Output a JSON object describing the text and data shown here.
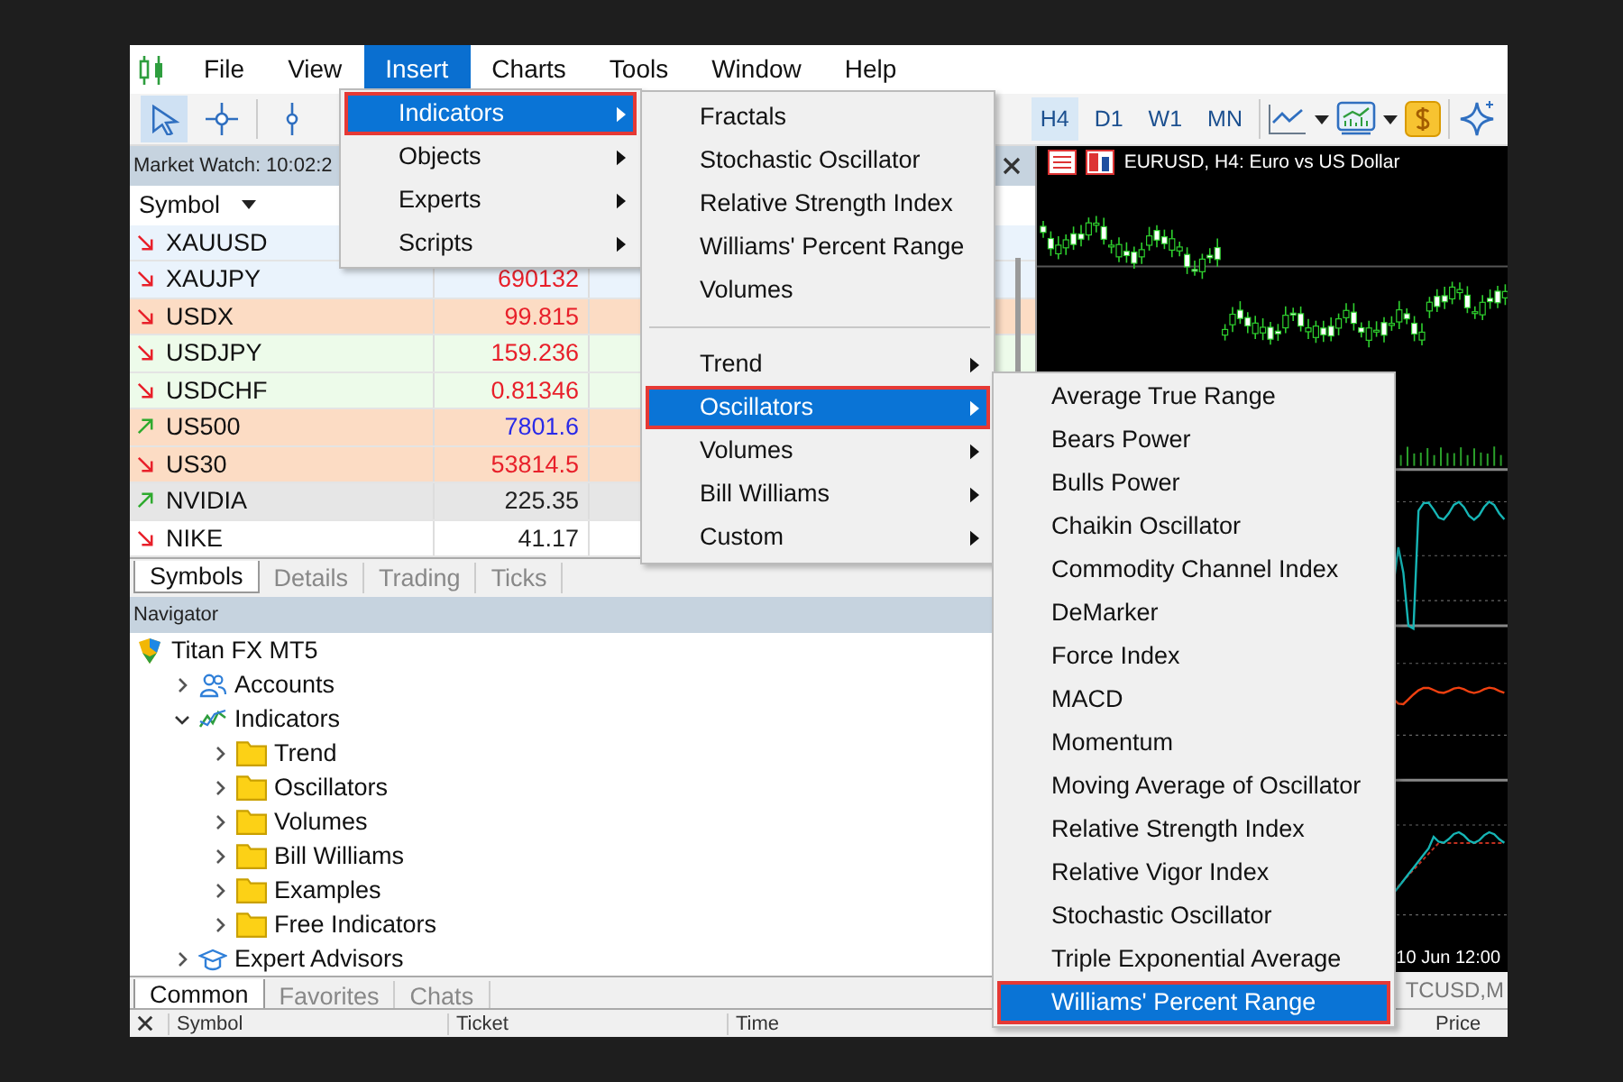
{
  "menu_bar": {
    "items": [
      {
        "label": "File",
        "selected": false
      },
      {
        "label": "View",
        "selected": false
      },
      {
        "label": "Insert",
        "selected": true
      },
      {
        "label": "Charts",
        "selected": false
      },
      {
        "label": "Tools",
        "selected": false
      },
      {
        "label": "Window",
        "selected": false
      },
      {
        "label": "Help",
        "selected": false
      }
    ]
  },
  "toolbar": {
    "timeframes": [
      {
        "label": "H4",
        "selected": true
      },
      {
        "label": "D1",
        "selected": false
      },
      {
        "label": "W1",
        "selected": false
      },
      {
        "label": "MN",
        "selected": false
      }
    ]
  },
  "market_watch": {
    "title": "Market Watch: 10:02:2",
    "column": "Symbol",
    "rows": [
      {
        "symbol": "XAUUSD",
        "rising": false,
        "color": "#eaf3fc"
      },
      {
        "symbol": "XAUJPY",
        "rising": false,
        "bid": {
          "text": "690132",
          "color": "#e8202a"
        },
        "color": "#eaf3fc"
      },
      {
        "symbol": "USDX",
        "rising": false,
        "bid": {
          "text": "99.815",
          "color": "#e8202a"
        },
        "color": "#fcdcc4"
      },
      {
        "symbol": "USDJPY",
        "rising": false,
        "bid": {
          "text": "159.236",
          "color": "#e8202a"
        },
        "color": "#edfbea"
      },
      {
        "symbol": "USDCHF",
        "rising": false,
        "bid": {
          "text": "0.81346",
          "color": "#e8202a"
        },
        "color": "#edfbea"
      },
      {
        "symbol": "US500",
        "rising": true,
        "bid": {
          "text": "7801.6",
          "color": "#2a2ae8"
        },
        "color": "#fcdcc4"
      },
      {
        "symbol": "US30",
        "rising": false,
        "bid": {
          "text": "53814.5",
          "color": "#e8202a"
        },
        "color": "#fcdcc4"
      },
      {
        "symbol": "NVIDIA",
        "rising": true,
        "bid": {
          "text": "225.35",
          "color": "#222222"
        },
        "color": "#e6e6e6"
      },
      {
        "symbol": "NIKE",
        "rising": false,
        "bid": {
          "text": "41.17",
          "color": "#222222"
        },
        "color": "#ffffff"
      }
    ],
    "tabs": [
      {
        "label": "Symbols",
        "selected": true
      },
      {
        "label": "Details",
        "selected": false
      },
      {
        "label": "Trading",
        "selected": false
      },
      {
        "label": "Ticks",
        "selected": false
      }
    ]
  },
  "navigator": {
    "title": "Navigator",
    "tree": [
      {
        "label": "Titan FX MT5",
        "kind": "root",
        "children": [
          {
            "label": "Accounts",
            "kind": "accounts",
            "expanded": false
          },
          {
            "label": "Indicators",
            "kind": "indicators",
            "expanded": true,
            "children": [
              {
                "label": "Trend",
                "kind": "folder",
                "expanded": false
              },
              {
                "label": "Oscillators",
                "kind": "folder",
                "expanded": false
              },
              {
                "label": "Volumes",
                "kind": "folder",
                "expanded": false
              },
              {
                "label": "Bill Williams",
                "kind": "folder",
                "expanded": false
              },
              {
                "label": "Examples",
                "kind": "folder",
                "expanded": false
              },
              {
                "label": "Free Indicators",
                "kind": "folder",
                "expanded": false
              }
            ]
          },
          {
            "label": "Expert Advisors",
            "kind": "experts",
            "expanded": false
          }
        ]
      }
    ],
    "tabs": [
      {
        "label": "Common",
        "selected": true
      },
      {
        "label": "Favorites",
        "selected": false
      },
      {
        "label": "Chats",
        "selected": false
      }
    ]
  },
  "chart": {
    "title": "EURUSD, H4:  Euro vs US Dollar",
    "time_label": "10 Jun 12:00",
    "tab": "TCUSD,M"
  },
  "toolbox": {
    "columns": [
      "Symbol",
      "Ticket",
      "Time",
      "Price"
    ]
  },
  "insert_menu": {
    "items": [
      {
        "label": "Indicators",
        "selected": true,
        "submenu": true
      },
      {
        "label": "Objects",
        "selected": false,
        "submenu": true
      },
      {
        "label": "Experts",
        "selected": false,
        "submenu": true
      },
      {
        "label": "Scripts",
        "selected": false,
        "submenu": true
      }
    ]
  },
  "indicators_menu": {
    "items": [
      {
        "kind": "item",
        "label": "Fractals",
        "selected": false
      },
      {
        "kind": "item",
        "label": "Stochastic Oscillator",
        "selected": false
      },
      {
        "kind": "item",
        "label": "Relative Strength Index",
        "selected": false
      },
      {
        "kind": "item",
        "label": "Williams' Percent Range",
        "selected": false
      },
      {
        "kind": "item",
        "label": "Volumes",
        "selected": false
      },
      {
        "kind": "separator"
      },
      {
        "kind": "submenu",
        "label": "Trend",
        "selected": false
      },
      {
        "kind": "submenu",
        "label": "Oscillators",
        "selected": true
      },
      {
        "kind": "submenu",
        "label": "Volumes",
        "selected": false
      },
      {
        "kind": "submenu",
        "label": "Bill Williams",
        "selected": false
      },
      {
        "kind": "submenu",
        "label": "Custom",
        "selected": false
      }
    ]
  },
  "oscillators_menu": {
    "items": [
      {
        "label": "Average True Range",
        "selected": false
      },
      {
        "label": "Bears Power",
        "selected": false
      },
      {
        "label": "Bulls Power",
        "selected": false
      },
      {
        "label": "Chaikin Oscillator",
        "selected": false
      },
      {
        "label": "Commodity Channel Index",
        "selected": false
      },
      {
        "label": "DeMarker",
        "selected": false
      },
      {
        "label": "Force Index",
        "selected": false
      },
      {
        "label": "MACD",
        "selected": false
      },
      {
        "label": "Momentum",
        "selected": false
      },
      {
        "label": "Moving Average of Oscillator",
        "selected": false
      },
      {
        "label": "Relative Strength Index",
        "selected": false
      },
      {
        "label": "Relative Vigor Index",
        "selected": false
      },
      {
        "label": "Stochastic Oscillator",
        "selected": false
      },
      {
        "label": "Triple Exponential Average",
        "selected": false
      },
      {
        "label": "Williams' Percent Range",
        "selected": true
      }
    ]
  }
}
